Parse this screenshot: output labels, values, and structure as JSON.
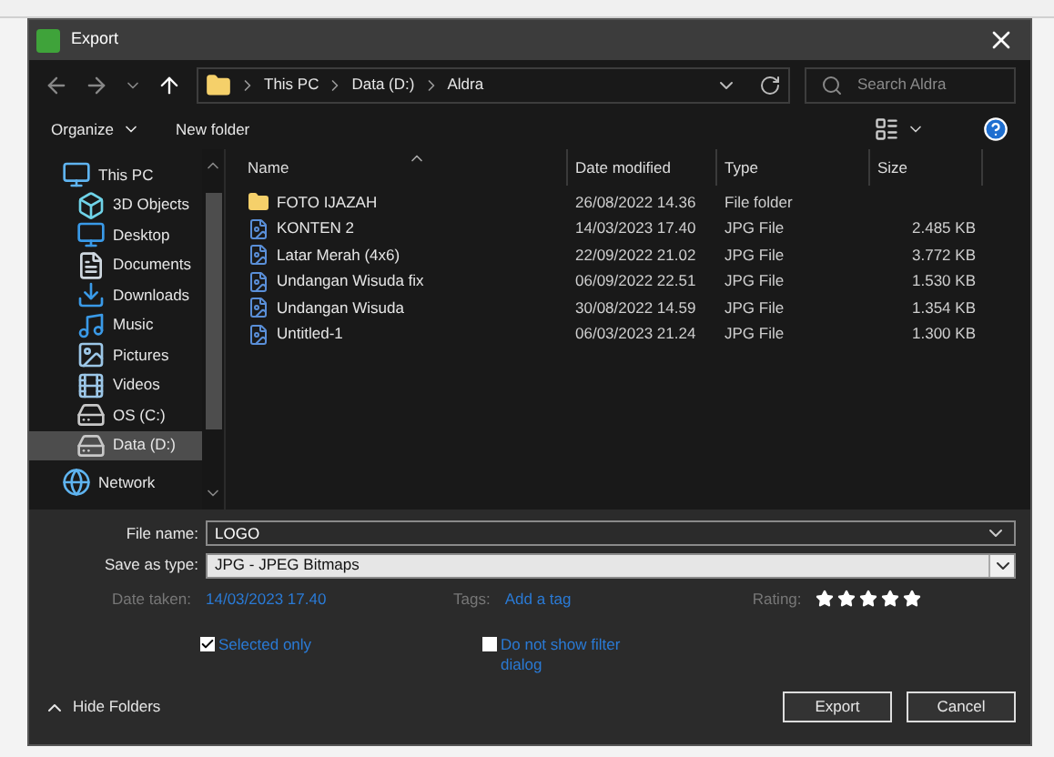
{
  "window": {
    "title": "Export"
  },
  "address": {
    "path": [
      "This PC",
      "Data (D:)",
      "Aldra"
    ],
    "search_placeholder": "Search Aldra"
  },
  "toolbar": {
    "organize": "Organize",
    "new_folder": "New folder"
  },
  "sidebar": {
    "items": [
      {
        "label": "This PC",
        "kind": "pc",
        "selected": false,
        "children": [
          {
            "label": "3D Objects",
            "kind": "objects",
            "selected": false
          },
          {
            "label": "Desktop",
            "kind": "desktop",
            "selected": false
          },
          {
            "label": "Documents",
            "kind": "documents",
            "selected": false
          },
          {
            "label": "Downloads",
            "kind": "downloads",
            "selected": false
          },
          {
            "label": "Music",
            "kind": "music",
            "selected": false
          },
          {
            "label": "Pictures",
            "kind": "pictures",
            "selected": false
          },
          {
            "label": "Videos",
            "kind": "videos",
            "selected": false
          },
          {
            "label": "OS (C:)",
            "kind": "drive",
            "selected": false
          },
          {
            "label": "Data (D:)",
            "kind": "drive",
            "selected": true
          }
        ]
      },
      {
        "label": "Network",
        "kind": "network",
        "selected": false
      }
    ]
  },
  "table": {
    "columns": [
      "Name",
      "Date modified",
      "Type",
      "Size"
    ],
    "rows": [
      {
        "name": "FOTO IJAZAH",
        "date": "26/08/2022 14.36",
        "type": "File folder",
        "kind": "folder"
      },
      {
        "name": "KONTEN 2",
        "date": "14/03/2023 17.40",
        "type": "JPG File",
        "size": "2.485 KB",
        "kind": "image"
      },
      {
        "name": "Latar Merah (4x6)",
        "date": "22/09/2022 21.02",
        "type": "JPG File",
        "size": "3.772 KB",
        "kind": "image"
      },
      {
        "name": "Undangan Wisuda fix",
        "date": "06/09/2022 22.51",
        "type": "JPG File",
        "size": "1.530 KB",
        "kind": "image"
      },
      {
        "name": "Undangan Wisuda",
        "date": "30/08/2022 14.59",
        "type": "JPG File",
        "size": "1.354 KB",
        "kind": "image"
      },
      {
        "name": "Untitled-1",
        "date": "06/03/2023 21.24",
        "type": "JPG File",
        "size": "1.300 KB",
        "kind": "image"
      }
    ]
  },
  "form": {
    "file_name_label": "File name:",
    "file_name": "LOGO",
    "type_label": "Save as type:",
    "type": "JPG - JPEG Bitmaps",
    "date_taken_label": "Date taken:",
    "date_taken": "14/03/2023 17.40",
    "tags_label": "Tags:",
    "tags_link": "Add a tag",
    "rating_label": "Rating:",
    "stars": 5,
    "options": [
      {
        "label": "Selected only",
        "checked": true
      },
      {
        "label": "Do not show filter dialog",
        "checked": false
      }
    ]
  },
  "footer": {
    "hide_folders": "Hide Folders",
    "buttons": [
      "Export",
      "Cancel"
    ]
  }
}
